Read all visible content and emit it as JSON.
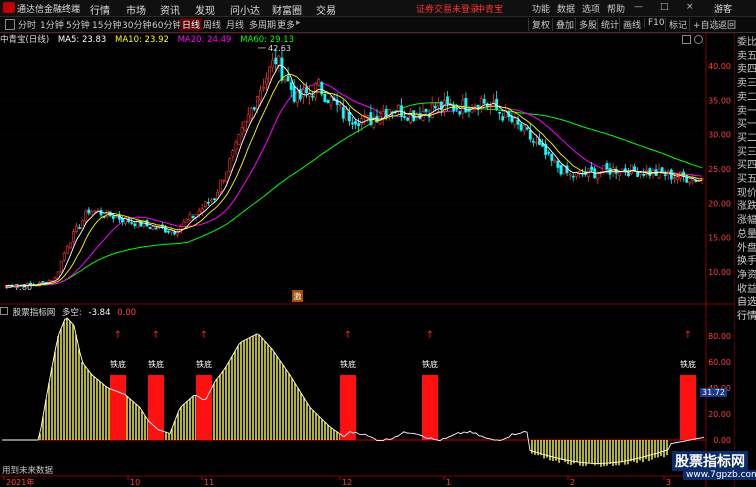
{
  "app": {
    "brand": "通达信金融终端",
    "login_warning": "证券交易未登录",
    "stock_name": "中青宝",
    "guest": "游客"
  },
  "menu": [
    "行情",
    "市场",
    "资讯",
    "发现",
    "问小达",
    "财富圈",
    "交易"
  ],
  "window_controls": [
    "—",
    "□",
    "×"
  ],
  "toolbar": {
    "periods": [
      "分时",
      "1分钟",
      "5分钟",
      "15分钟",
      "30分钟",
      "60分钟",
      "日线",
      "周线",
      "月线",
      "多周期",
      "更多"
    ],
    "active": "日线",
    "right_buttons": [
      "复权",
      "叠加",
      "多股",
      "统计",
      "画线",
      "F10",
      "标记",
      "+自选",
      "返回"
    ]
  },
  "ma_legend": {
    "stock": "中青宝(日线)",
    "ma5": "MA5: 23.83",
    "ma10": "MA10: 23.92",
    "ma20": "MA20: 24.49",
    "ma60": "MA60: 29.13",
    "colors": {
      "ma5": "#ffffff",
      "ma10": "#ffff00",
      "ma20": "#ff00ff",
      "ma60": "#00ff00"
    }
  },
  "price_axis": [
    "40.00",
    "35.00",
    "30.00",
    "25.00",
    "20.00",
    "15.00",
    "10.00"
  ],
  "price_labels": {
    "high": "42.63",
    "low": "7.80"
  },
  "event_badge": "激",
  "indicator": {
    "name": "股票指标网",
    "label": "多空:",
    "value": "-3.84",
    "zero": "0.00",
    "axis": [
      "80.00",
      "60.00",
      "40.00",
      "20.00",
      "0.00"
    ],
    "current": "31.72",
    "signal_label": "铁底"
  },
  "date_axis": [
    "2021年",
    "10",
    "11",
    "12",
    "1",
    "2",
    "3"
  ],
  "right_panel": [
    "委比",
    "卖五",
    "卖四",
    "卖三",
    "卖二",
    "卖一",
    "买一",
    "买二",
    "买三",
    "买四",
    "买五",
    "现价",
    "涨跌",
    "涨幅",
    "总量",
    "外盘",
    "换手",
    "净资",
    "收益",
    "自选",
    "行情"
  ],
  "bottom_note": "用到未来数据",
  "watermark": {
    "title": "股票指标网",
    "url": "www.7gpzb.com"
  }
}
